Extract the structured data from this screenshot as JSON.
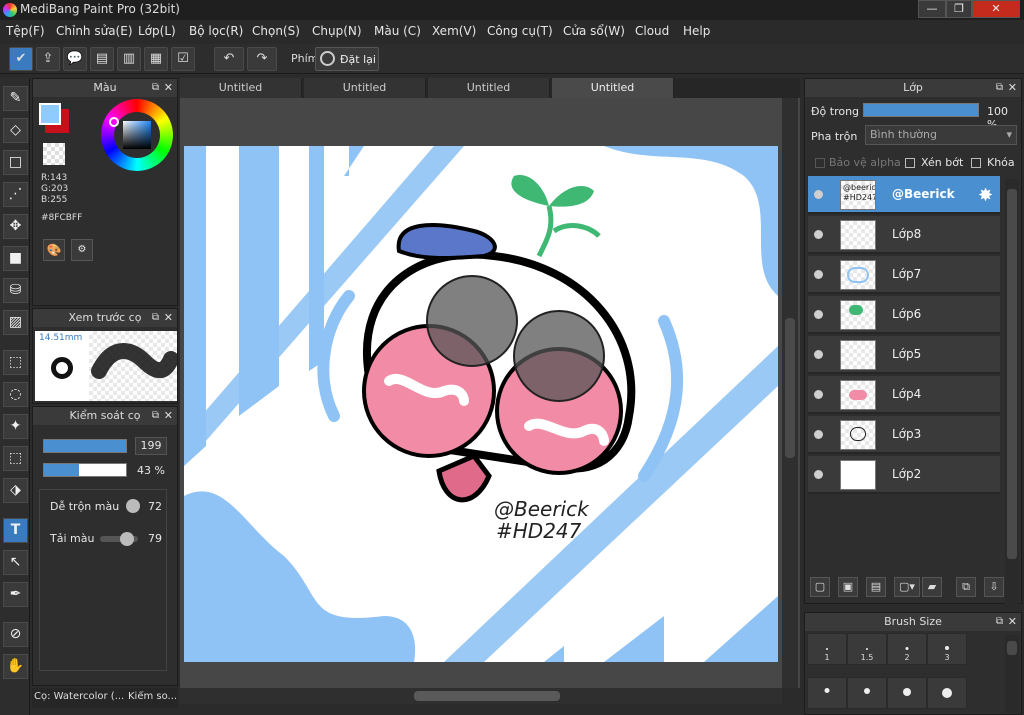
{
  "window": {
    "title": "MediBang Paint Pro (32bit)",
    "minimize": "—",
    "maximize": "❐",
    "close": "✕"
  },
  "menu": [
    "Tệp(F)",
    "Chỉnh sửa(E)",
    "Lớp(L)",
    "Bộ lọc(R)",
    "Chọn(S)",
    "Chụp(N)",
    "Màu (C)",
    "Xem(V)",
    "Công cụ(T)",
    "Cửa sổ(W)",
    "Cloud",
    "Help"
  ],
  "toolbar": {
    "shortcut_label": "Phím",
    "reset_label": "Đặt lại"
  },
  "tabs": [
    "Untitled",
    "Untitled",
    "Untitled",
    "Untitled"
  ],
  "color_panel": {
    "title": "Màu",
    "r": "R:143",
    "g": "G:203",
    "b": "B:255",
    "hex": "#8FCBFF",
    "fg_color": "#8FCBFF",
    "bg_color": "#C8101A"
  },
  "preview_panel": {
    "title": "Xem trước cọ",
    "size": "14.51mm"
  },
  "brush_control": {
    "title": "Kiểm soát cọ",
    "size_value": "199",
    "opacity_value": "43 %",
    "opacity_fraction": 0.43,
    "blend_label": "Dễ trộn màu",
    "blend_value": "72",
    "load_label": "Tải màu",
    "load_value": "79"
  },
  "bottom_left": {
    "brush_tab": "Cọ: Watercolor (...",
    "control_tab": "Kiểm so..."
  },
  "layer_panel": {
    "title": "Lớp",
    "opacity_label": "Độ trong",
    "opacity_value": "100 %",
    "blend_label": "Pha trộn",
    "blend_value": "Bình thường",
    "protect_alpha": "Bảo vệ alpha",
    "clipping": "Xén bớt",
    "lock": "Khóa",
    "layers": [
      "@Beerick",
      "Lớp8",
      "Lớp7",
      "Lớp6",
      "Lớp5",
      "Lớp4",
      "Lớp3",
      "Lớp2"
    ]
  },
  "brush_size_panel": {
    "title": "Brush Size",
    "sizes": [
      "1",
      "1.5",
      "2",
      "3"
    ]
  },
  "artwork": {
    "signature_line1": "@Beerick",
    "signature_line2": "#HD247",
    "thumb_text": "@beerick #HD247"
  }
}
